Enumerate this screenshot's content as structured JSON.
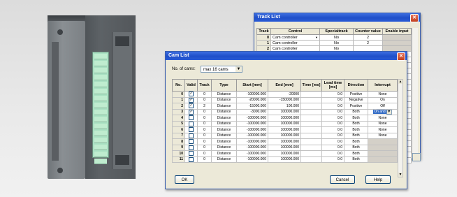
{
  "track_list": {
    "title": "Track List",
    "columns": [
      "Track",
      "Control",
      "Specialtrack",
      "Counter value",
      "Enable input"
    ],
    "rows": [
      {
        "track": "0",
        "control": "Cam controller",
        "special": "No",
        "counter": "2",
        "dropdown": true
      },
      {
        "track": "1",
        "control": "Cam controller",
        "special": "No",
        "counter": "2",
        "dropdown": false
      },
      {
        "track": "2",
        "control": "Cam controller",
        "special": "No",
        "counter": "",
        "dropdown": false
      }
    ]
  },
  "cam_list": {
    "title": "Cam List",
    "no_of_cams_label": "No. of cams:",
    "no_of_cams_value": "max 16 cams",
    "columns": [
      "No.",
      "Valid",
      "Track",
      "Type",
      "Start [mm]",
      "End [mm]",
      "Time [ms]",
      "Lead time [ms]",
      "Direction",
      "Interrupt"
    ],
    "rows": [
      {
        "no": "0",
        "valid": true,
        "track": "0",
        "type": "Distance",
        "start": "-100000.000",
        "end": "-20000",
        "time": "",
        "lead": "0.0",
        "direction": "Positive",
        "interrupt": "None"
      },
      {
        "no": "1",
        "valid": true,
        "track": "0",
        "type": "Distance",
        "start": "-20000.000",
        "end": "-150000.000",
        "time": "",
        "lead": "0.0",
        "direction": "Negative",
        "interrupt": "On"
      },
      {
        "no": "2",
        "valid": true,
        "track": "2",
        "type": "Distance",
        "start": "-15000.000",
        "end": "100.000",
        "time": "",
        "lead": "0.0",
        "direction": "Positive",
        "interrupt": "Off"
      },
      {
        "no": "3",
        "valid": true,
        "track": "0",
        "type": "Distance",
        "start": "-3000.000",
        "end": "100000.000",
        "time": "",
        "lead": "0.0",
        "direction": "Both",
        "interrupt": "On and",
        "selected": true
      },
      {
        "no": "4",
        "valid": false,
        "track": "0",
        "type": "Distance",
        "start": "-100000.000",
        "end": "100000.000",
        "time": "",
        "lead": "0.0",
        "direction": "Both",
        "interrupt": "None"
      },
      {
        "no": "5",
        "valid": false,
        "track": "0",
        "type": "Distance",
        "start": "-100000.000",
        "end": "100000.000",
        "time": "",
        "lead": "0.0",
        "direction": "Both",
        "interrupt": "None"
      },
      {
        "no": "6",
        "valid": false,
        "track": "0",
        "type": "Distance",
        "start": "-100000.000",
        "end": "100000.000",
        "time": "",
        "lead": "0.0",
        "direction": "Both",
        "interrupt": "None"
      },
      {
        "no": "7",
        "valid": false,
        "track": "0",
        "type": "Distance",
        "start": "-100000.000",
        "end": "100000.000",
        "time": "",
        "lead": "0.0",
        "direction": "Both",
        "interrupt": "None"
      },
      {
        "no": "8",
        "valid": false,
        "track": "0",
        "type": "Distance",
        "start": "-100000.000",
        "end": "100000.000",
        "time": "",
        "lead": "0.0",
        "direction": "Both",
        "interrupt": ""
      },
      {
        "no": "9",
        "valid": false,
        "track": "0",
        "type": "Distance",
        "start": "-100000.000",
        "end": "100000.000",
        "time": "",
        "lead": "0.0",
        "direction": "Both",
        "interrupt": ""
      },
      {
        "no": "10",
        "valid": false,
        "track": "0",
        "type": "Distance",
        "start": "-100000.000",
        "end": "100000.000",
        "time": "",
        "lead": "0.0",
        "direction": "Both",
        "interrupt": ""
      },
      {
        "no": "11",
        "valid": false,
        "track": "0",
        "type": "Distance",
        "start": "-100000.000",
        "end": "100000.000",
        "time": "",
        "lead": "0.0",
        "direction": "Both",
        "interrupt": ""
      }
    ],
    "ok_label": "OK",
    "cancel_label": "Cancel",
    "help_label": "Help"
  },
  "colors": {
    "titlebar": "#1f4fc9",
    "window_bg": "#ece9d8",
    "selection": "#316ac5",
    "led_strip": "#a9e0c2"
  },
  "icons": {
    "close": "close-icon",
    "dropdown": "chevron-down-icon",
    "checkbox": "checkbox-icon"
  }
}
